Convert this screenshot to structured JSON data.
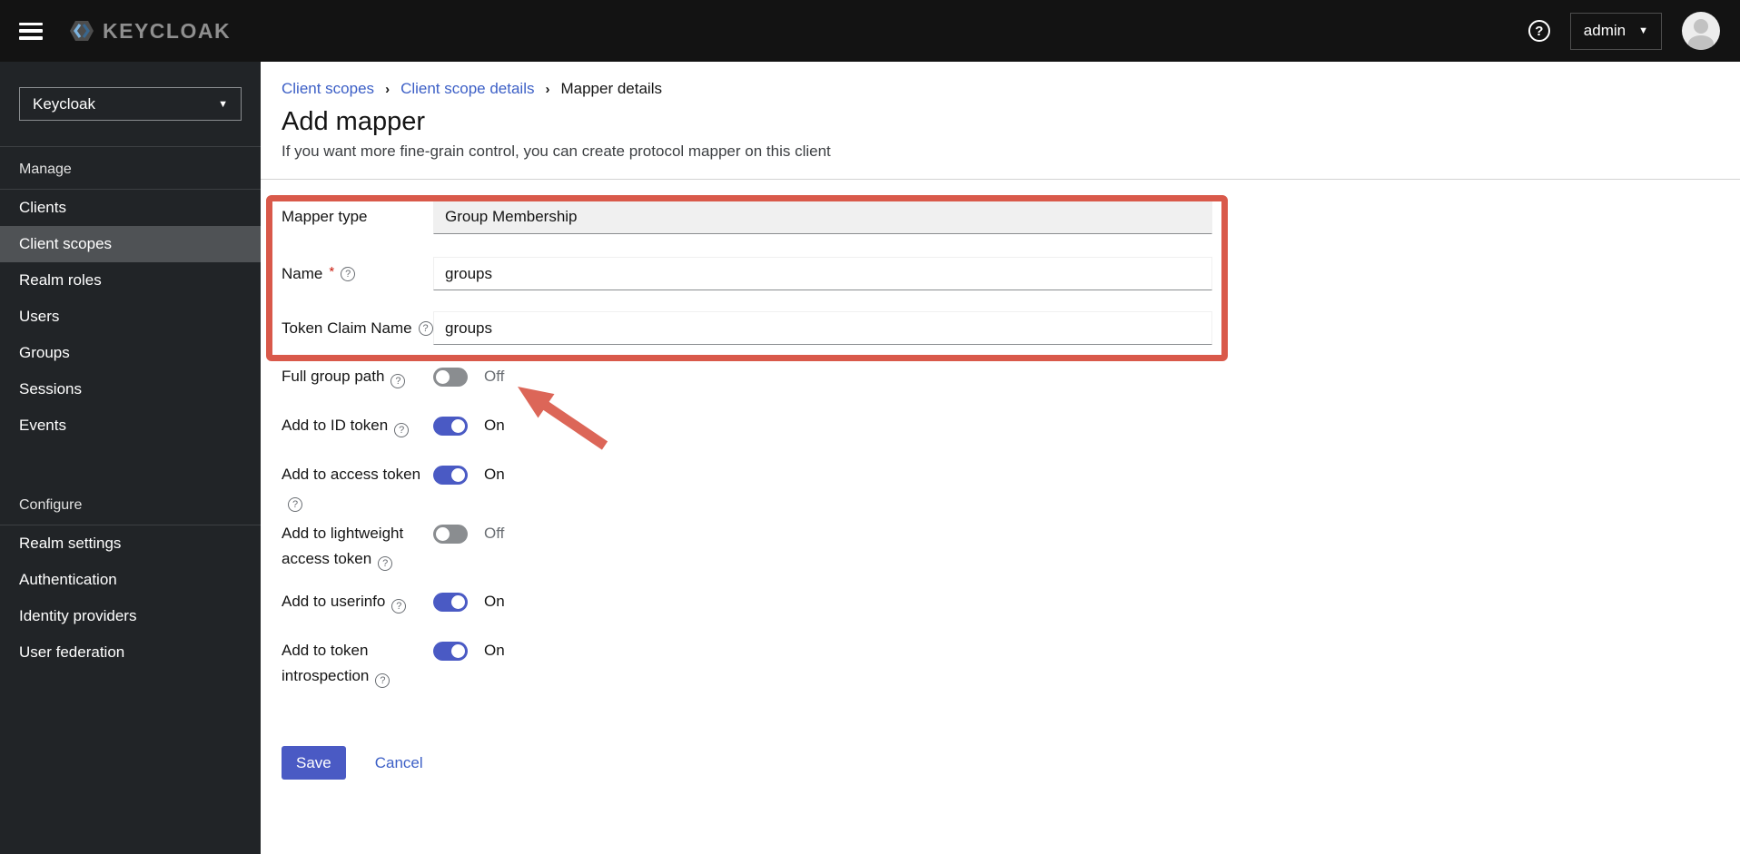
{
  "topbar": {
    "brand": "KEYCLOAK",
    "help_icon": "?",
    "user_menu": "admin"
  },
  "sidebar": {
    "realm_selector": "Keycloak",
    "sections": [
      {
        "title": "Manage",
        "items": [
          {
            "label": "Clients",
            "selected": false
          },
          {
            "label": "Client scopes",
            "selected": true
          },
          {
            "label": "Realm roles",
            "selected": false
          },
          {
            "label": "Users",
            "selected": false
          },
          {
            "label": "Groups",
            "selected": false
          },
          {
            "label": "Sessions",
            "selected": false
          },
          {
            "label": "Events",
            "selected": false
          }
        ]
      },
      {
        "title": "Configure",
        "items": [
          {
            "label": "Realm settings",
            "selected": false
          },
          {
            "label": "Authentication",
            "selected": false
          },
          {
            "label": "Identity providers",
            "selected": false
          },
          {
            "label": "User federation",
            "selected": false
          }
        ]
      }
    ]
  },
  "breadcrumb": {
    "links": [
      "Client scopes",
      "Client scope details"
    ],
    "current": "Mapper details"
  },
  "page": {
    "title": "Add mapper",
    "subtitle": "If you want more fine-grain control, you can create protocol mapper on this client"
  },
  "form": {
    "mapper_type": {
      "label": "Mapper type",
      "value": "Group Membership"
    },
    "name": {
      "label": "Name",
      "required_marker": "*",
      "value": "groups"
    },
    "token_claim_name": {
      "label": "Token Claim Name",
      "value": "groups"
    },
    "help_glyph": "?",
    "toggles": [
      {
        "label": "Full group path",
        "state": "Off"
      },
      {
        "label": "Add to ID token",
        "state": "On"
      },
      {
        "label": "Add to access token",
        "state": "On"
      },
      {
        "label": "Add to lightweight access token",
        "state": "Off"
      },
      {
        "label": "Add to userinfo",
        "state": "On"
      },
      {
        "label": "Add to token introspection",
        "state": "On"
      }
    ],
    "save_label": "Save",
    "cancel_label": "Cancel"
  },
  "colors": {
    "accent": "#4a5ac4",
    "link": "#3c5fc6",
    "annotation": "#d9594a"
  }
}
